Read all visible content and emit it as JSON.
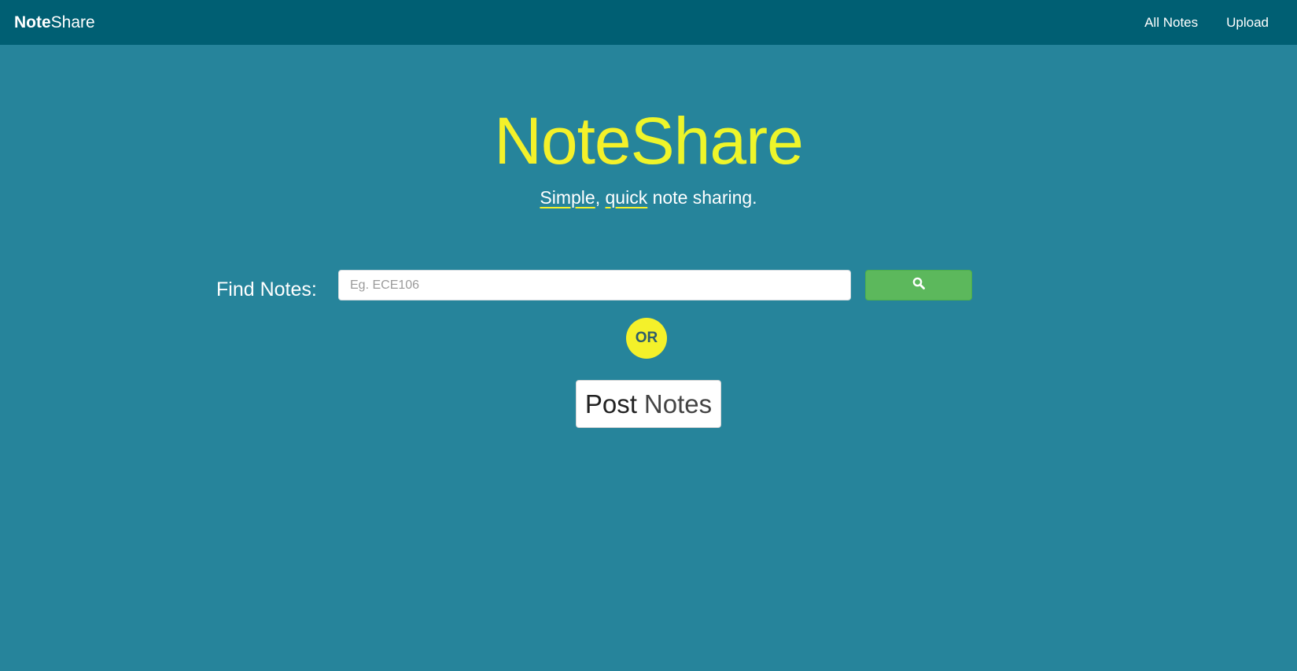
{
  "navbar": {
    "brand_bold": "Note",
    "brand_light": "Share",
    "links": [
      {
        "label": "All Notes"
      },
      {
        "label": "Upload"
      }
    ]
  },
  "hero": {
    "title_bold": "Note",
    "title_light": "Share",
    "tagline_word1": "Simple",
    "tagline_sep": ", ",
    "tagline_word2": "quick",
    "tagline_rest": " note sharing."
  },
  "search": {
    "label": "Find Notes:",
    "placeholder": "Eg. ECE106",
    "value": "",
    "button_icon": "search-icon"
  },
  "divider": {
    "or_label": "OR"
  },
  "post": {
    "label_bold": "Post",
    "label_light": "Notes"
  },
  "colors": {
    "background": "#26849b",
    "navbar": "#005f73",
    "accent_yellow": "#f4f12a",
    "search_button": "#5cb85c"
  }
}
